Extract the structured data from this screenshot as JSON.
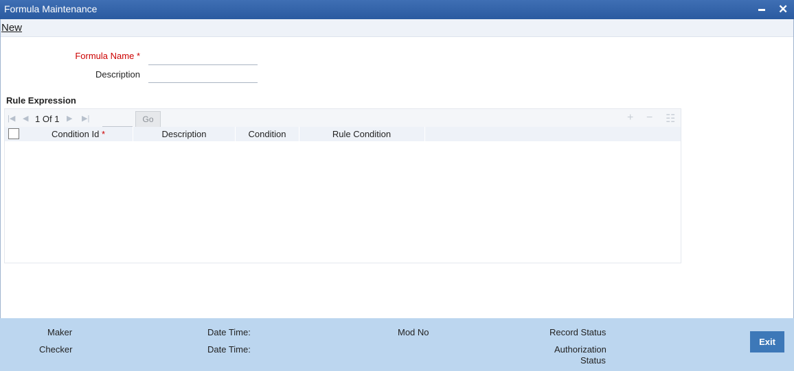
{
  "window": {
    "title": "Formula Maintenance",
    "minimize_glyph": "▬",
    "close_glyph": "✕"
  },
  "menu": {
    "new_label": "New"
  },
  "form": {
    "formula_name_label": "Formula Name",
    "formula_name_value": "",
    "description_label": "Description",
    "description_value": "",
    "required_marker": "*"
  },
  "rule_expression": {
    "title": "Rule Expression",
    "pagination": {
      "current": "1",
      "of_label": "Of",
      "total": "1",
      "go_label": "Go"
    },
    "columns": [
      {
        "label": "Condition Id",
        "required": true
      },
      {
        "label": "Description"
      },
      {
        "label": "Condition"
      },
      {
        "label": "Rule Condition"
      }
    ],
    "rows": []
  },
  "footer": {
    "maker_label": "Maker",
    "checker_label": "Checker",
    "date_time_label": "Date Time:",
    "mod_no_label": "Mod No",
    "record_status_label": "Record Status",
    "authorization_label": "Authorization",
    "status_label": "Status",
    "exit_label": "Exit"
  },
  "icons": {
    "first": "first-page-icon",
    "prev": "prev-page-icon",
    "next": "next-page-icon",
    "last": "last-page-icon",
    "add": "add-row-icon",
    "delete": "delete-row-icon",
    "view": "single-view-icon"
  },
  "colors": {
    "titlebar": "#2f60a8",
    "footer": "#bcd6ef",
    "exit_button": "#3d78b8",
    "required": "#cc0000"
  }
}
